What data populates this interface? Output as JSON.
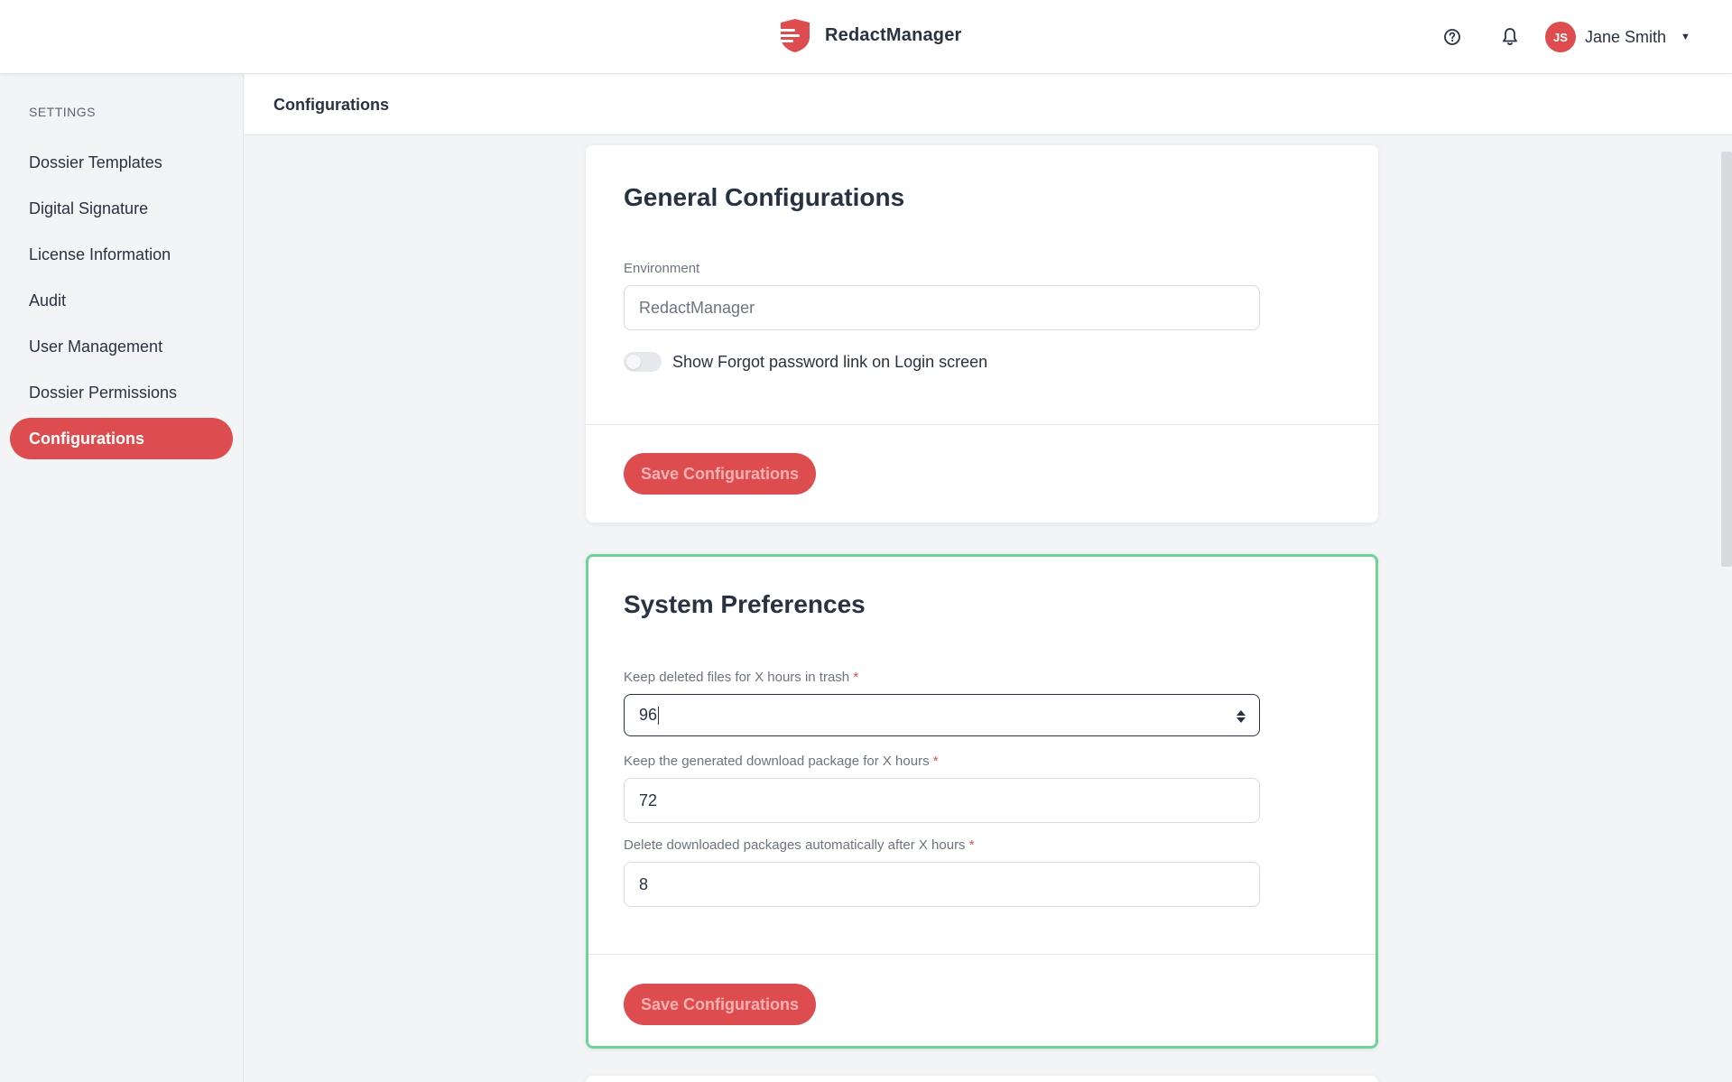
{
  "app": {
    "name": "RedactManager",
    "user": {
      "initials": "JS",
      "name": "Jane Smith"
    },
    "icons": {
      "help": "help-circle-icon",
      "notifications": "bell-icon",
      "menu": "caret-down-icon",
      "logo": "shield-logo-icon"
    },
    "brand_color": "#dd4d50"
  },
  "sidebar": {
    "heading": "SETTINGS",
    "items": [
      {
        "label": "Dossier Templates",
        "active": false
      },
      {
        "label": "Digital Signature",
        "active": false
      },
      {
        "label": "License Information",
        "active": false
      },
      {
        "label": "Audit",
        "active": false
      },
      {
        "label": "User Management",
        "active": false
      },
      {
        "label": "Dossier Permissions",
        "active": false
      },
      {
        "label": "Configurations",
        "active": true
      }
    ]
  },
  "page": {
    "title": "Configurations"
  },
  "general": {
    "title": "General Configurations",
    "environment_label": "Environment",
    "environment_value": "RedactManager",
    "forgot_password_toggle_label": "Show Forgot password link on Login screen",
    "forgot_password_enabled": false,
    "save_label": "Save Configurations"
  },
  "system": {
    "title": "System Preferences",
    "trash_label": "Keep deleted files for X hours in trash",
    "trash_value": "96",
    "download_keep_label": "Keep the generated download package for X hours",
    "download_keep_value": "72",
    "delete_after_label": "Delete downloaded packages automatically after X hours",
    "delete_after_value": "8",
    "required_mark": "*",
    "save_label": "Save Configurations",
    "highlight_color": "#6fd398"
  }
}
